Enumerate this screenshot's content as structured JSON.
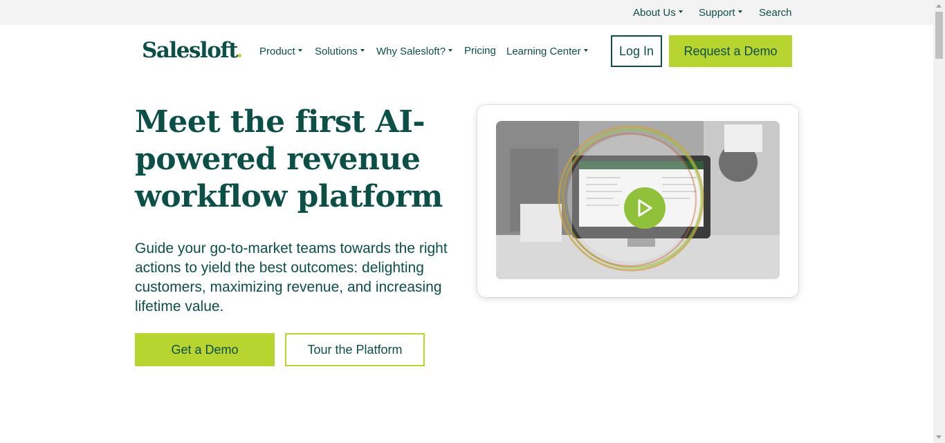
{
  "utility_nav": {
    "about": "About Us",
    "support": "Support",
    "search": "Search"
  },
  "brand": {
    "logo_text": "Salesloft",
    "accent_color": "#b8d431",
    "primary_color": "#0b4f47"
  },
  "main_nav": {
    "product": "Product",
    "solutions": "Solutions",
    "why": "Why Salesloft?",
    "pricing": "Pricing",
    "learning": "Learning Center",
    "login": "Log In",
    "request_demo": "Request a Demo"
  },
  "hero": {
    "title": "Meet the first AI-powered revenue workflow platform",
    "subtitle": "Guide your go-to-market teams towards the right actions to yield the best outcomes: delighting customers, maximizing revenue, and increasing lifetime value.",
    "cta_primary": "Get a Demo",
    "cta_secondary": "Tour the Platform"
  },
  "video": {
    "icon": "play-icon"
  }
}
